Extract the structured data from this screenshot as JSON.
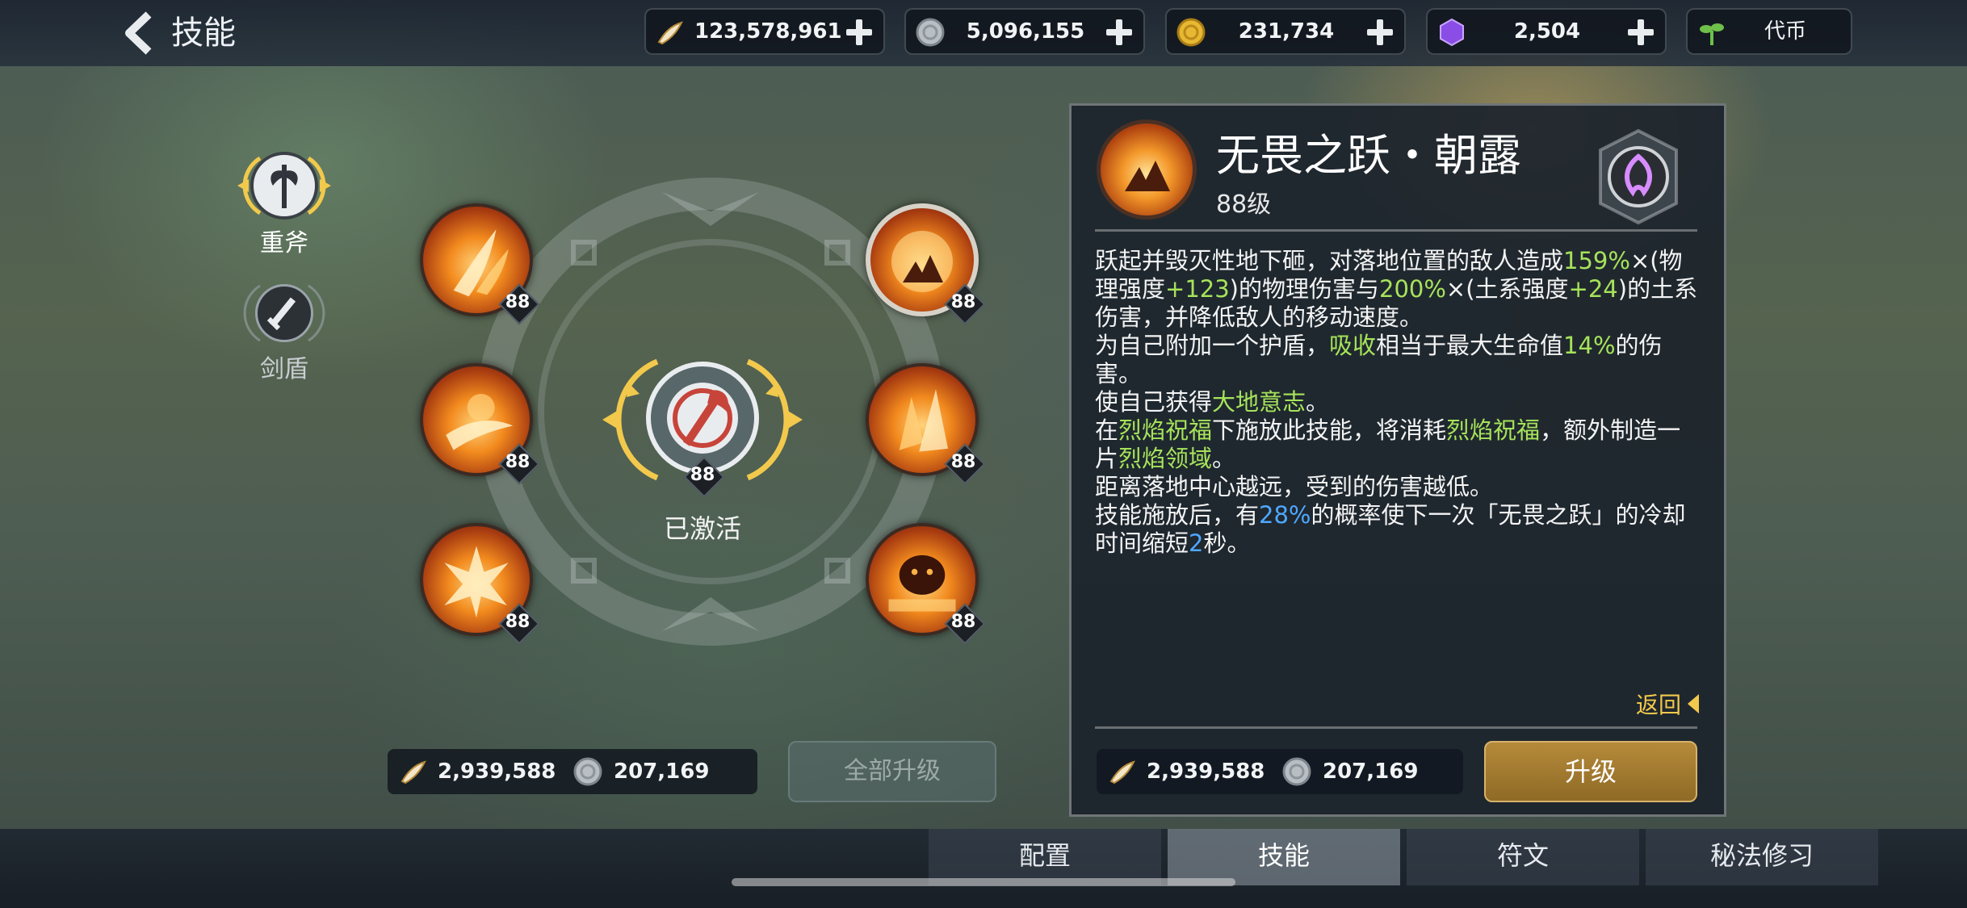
{
  "header": {
    "title": "技能"
  },
  "currencies": [
    {
      "name": "horn",
      "icon": "horn-icon",
      "value": "123,578,961"
    },
    {
      "name": "silver",
      "icon": "silver-coin-icon",
      "value": "5,096,155"
    },
    {
      "name": "gold",
      "icon": "gold-coin-icon",
      "value": "231,734"
    },
    {
      "name": "gem",
      "icon": "purple-gem-icon",
      "value": "2,504"
    },
    {
      "name": "token",
      "icon": "sprout-icon",
      "value": "代币"
    }
  ],
  "weapons": [
    {
      "label": "重斧",
      "icon": "axe-icon",
      "selected": true
    },
    {
      "label": "剑盾",
      "icon": "sword-icon",
      "selected": false
    }
  ],
  "skills": {
    "level": "88",
    "items": [
      {
        "name": "slash",
        "level": "88"
      },
      {
        "name": "wind-slash",
        "level": "88"
      },
      {
        "name": "burst",
        "level": "88"
      },
      {
        "name": "fearless-leap",
        "level": "88",
        "selected": true
      },
      {
        "name": "rock-spike",
        "level": "88"
      },
      {
        "name": "fire-golem",
        "level": "88"
      }
    ],
    "center": {
      "level": "88",
      "status": "已激活"
    }
  },
  "left_cost": {
    "horn": "2,939,588",
    "silver": "207,169"
  },
  "upgrade_all_label": "全部升级",
  "panel": {
    "skill_name": "无畏之跃・朝露",
    "skill_level": "88级",
    "desc": {
      "p1_a": "跃起并毁灭性地下砸，对落地位置的敌人造成",
      "p1_b": "159%",
      "p1_c": "×(物理强度",
      "p1_d": "+123",
      "p1_e": ")的物理伤害与",
      "p1_f": "200%",
      "p1_g": "×(土系强度",
      "p1_h": "+24",
      "p1_i": ")的土系伤害，并降低敌人的移动速度。",
      "p2_a": "为自己附加一个护盾，",
      "p2_b": "吸收",
      "p2_c": "相当于最大生命值",
      "p2_d": "14%",
      "p2_e": "的伤害。",
      "p3_a": "使自己获得",
      "p3_b": "大地意志",
      "p3_c": "。",
      "p4_a": "在",
      "p4_b": "烈焰祝福",
      "p4_c": "下施放此技能，将消耗",
      "p4_d": "烈焰祝福",
      "p4_e": "，额外制造一片",
      "p4_f": "烈焰领域",
      "p4_g": "。",
      "p5": "距离落地中心越远，受到的伤害越低。",
      "p6_a": "技能施放后，有",
      "p6_b": "28%",
      "p6_c": "的概率使下一次「无畏之跃」的冷却时间缩短",
      "p6_d": "2",
      "p6_e": "秒。"
    },
    "return_label": "返回",
    "cost": {
      "horn": "2,939,588",
      "silver": "207,169"
    },
    "upgrade_label": "升级"
  },
  "tabs": [
    {
      "label": "配置",
      "active": false
    },
    {
      "label": "技能",
      "active": true
    },
    {
      "label": "符文",
      "active": false
    },
    {
      "label": "秘法修习",
      "active": false
    }
  ],
  "colors": {
    "highlight_green": "#a6e35a",
    "highlight_blue": "#4fa8ff",
    "accent_gold": "#f2c94c"
  }
}
